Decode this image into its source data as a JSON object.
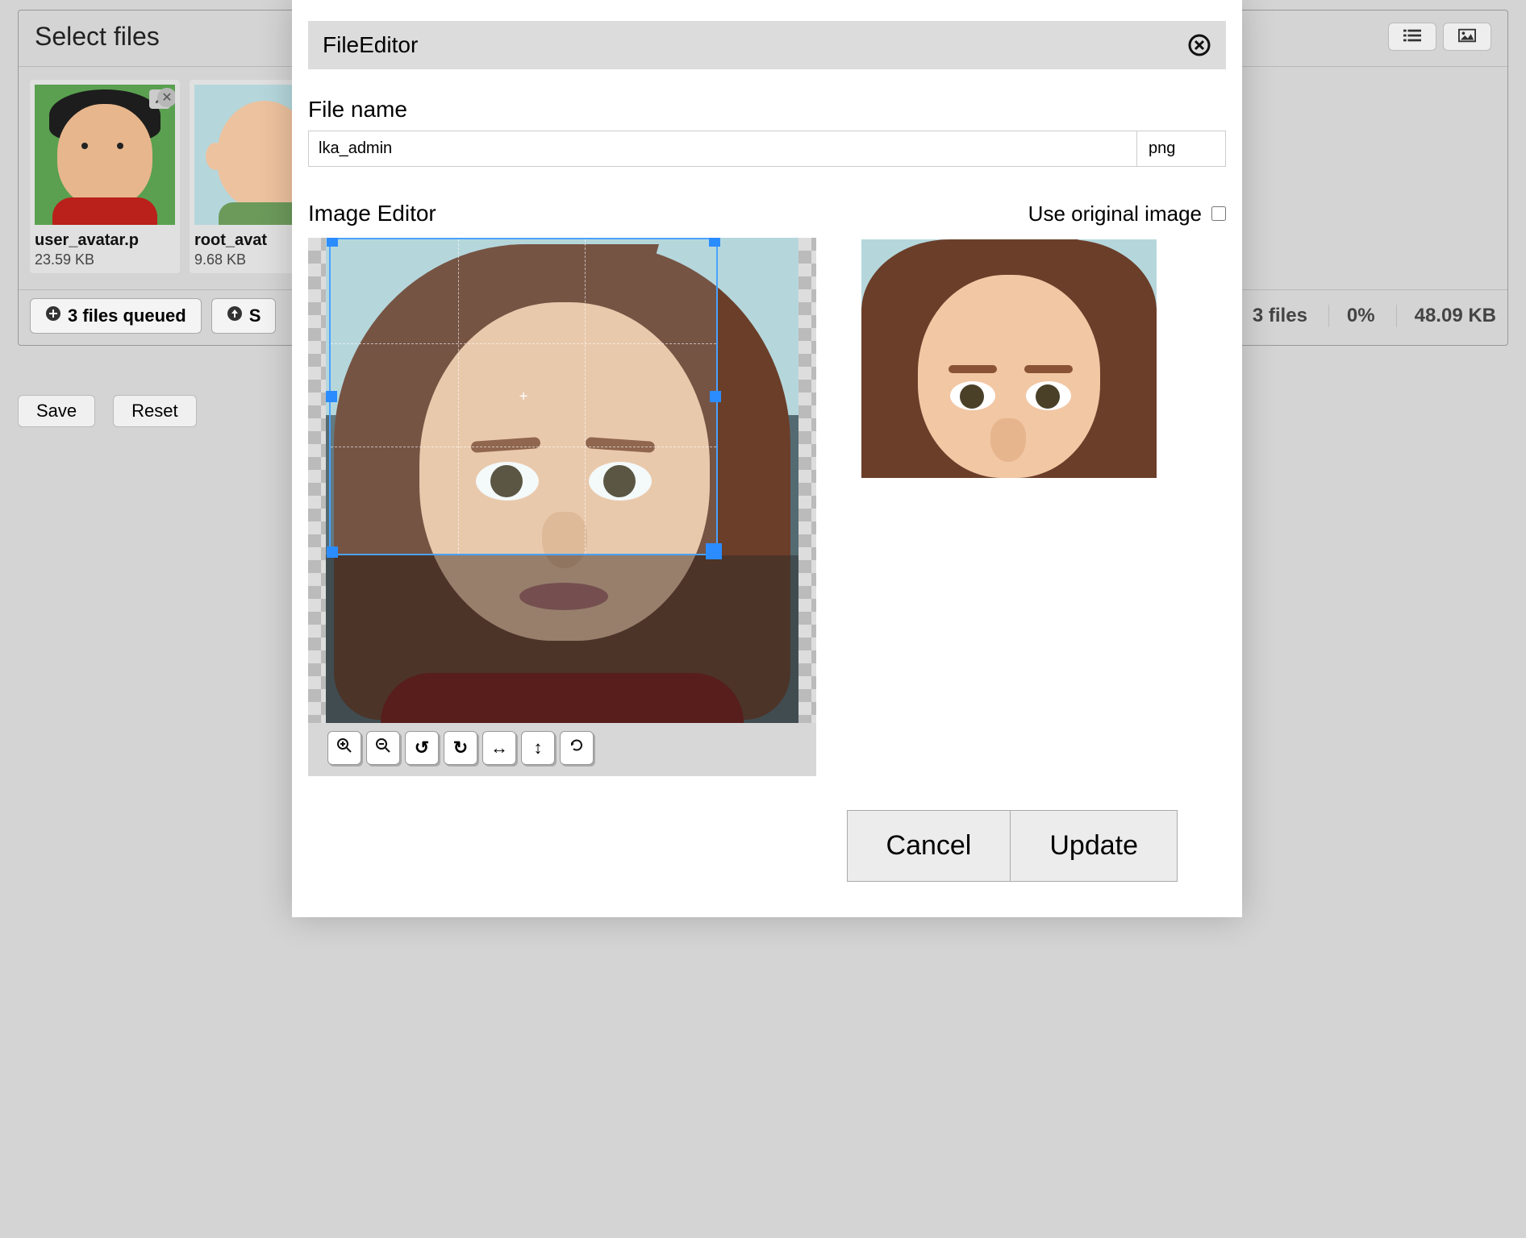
{
  "panel": {
    "title": "Select files"
  },
  "thumbs": [
    {
      "name": "user_avatar.p",
      "size": "23.59 KB"
    },
    {
      "name": "root_avat",
      "size": "9.68 KB"
    }
  ],
  "status": {
    "queued": "3 files queued",
    "start": "S",
    "files": "3 files",
    "percent": "0%",
    "total": "48.09 KB"
  },
  "actions": {
    "save": "Save",
    "reset": "Reset"
  },
  "modal": {
    "title": "FileEditor",
    "filename_label": "File name",
    "filename_value": "lka_admin",
    "ext": "png",
    "editor_label": "Image Editor",
    "use_original": "Use original image",
    "cancel": "Cancel",
    "update": "Update"
  },
  "tools": {
    "zoom_in": "zoom-in",
    "zoom_out": "zoom-out",
    "rotate_left": "rotate-left",
    "rotate_right": "rotate-right",
    "flip_h": "flip-horizontal",
    "flip_v": "flip-vertical",
    "reset": "reset"
  }
}
